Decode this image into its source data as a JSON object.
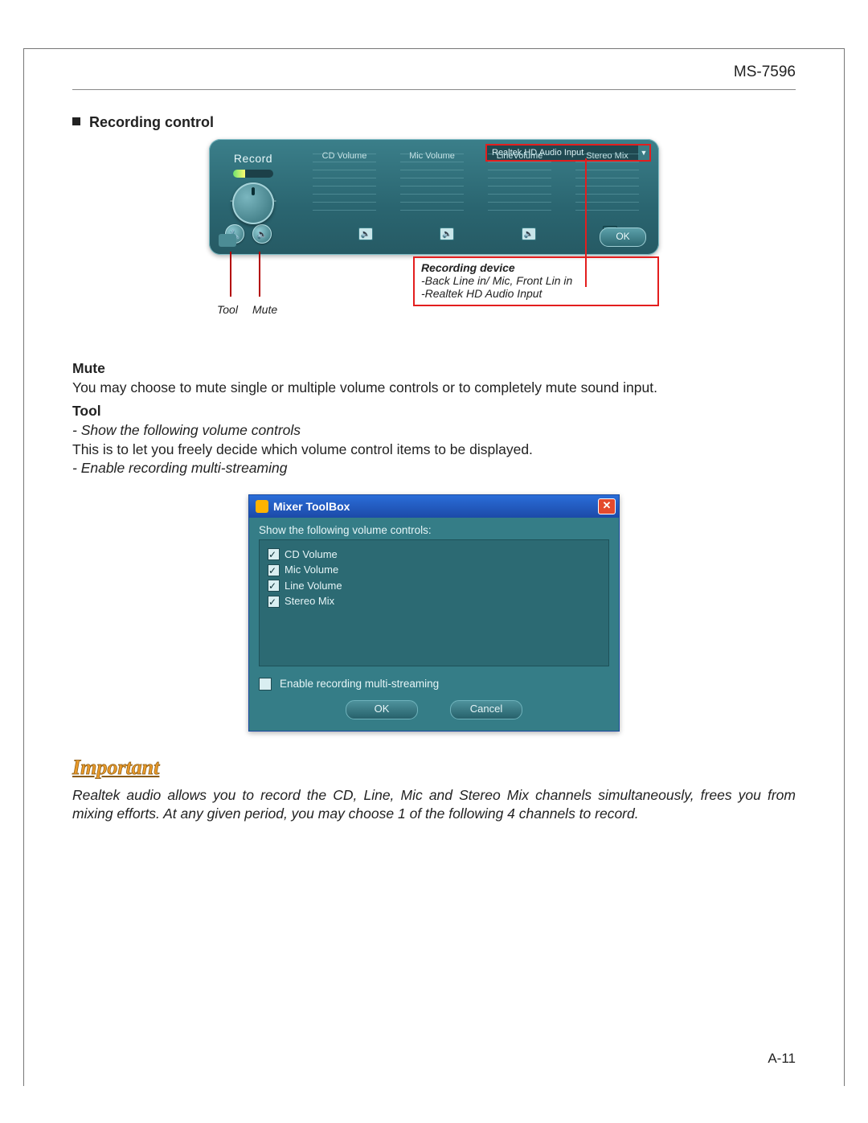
{
  "header": {
    "model": "MS-7596"
  },
  "section_title": "Recording control",
  "rec_panel": {
    "label": "Record",
    "columns": [
      "CD Volume",
      "Mic Volume",
      "LineVolume",
      "Stereo Mix"
    ],
    "dropdown": "Realtek HD Audio Input",
    "ok": "OK"
  },
  "callouts": {
    "tool": "Tool",
    "mute": "Mute",
    "device_head": "Recording device",
    "device_line1": "-Back Line in/ Mic, Front Lin in",
    "device_line2": "-Realtek HD Audio Input"
  },
  "body": {
    "mute_h": "Mute",
    "mute_p": "You may choose to mute single or multiple volume controls or to completely mute sound input.",
    "tool_h": "Tool",
    "tool_item1": "- Show the following volume controls",
    "tool_item1_p": "This is to let you freely decide which volume control items to be displayed.",
    "tool_item2": "- Enable recording multi-streaming"
  },
  "mixer": {
    "title": "Mixer ToolBox",
    "subtitle": "Show the following volume controls:",
    "items": [
      "CD Volume",
      "Mic Volume",
      "Line Volume",
      "Stereo Mix"
    ],
    "enable": "Enable recording multi-streaming",
    "ok": "OK",
    "cancel": "Cancel"
  },
  "important": {
    "label": "Important",
    "text": "Realtek audio allows you to record the CD, Line, Mic and Stereo Mix channels simultaneously, frees you from mixing efforts. At any given period, you may choose 1 of the following 4 channels to record."
  },
  "footer": {
    "page": "A-11"
  }
}
